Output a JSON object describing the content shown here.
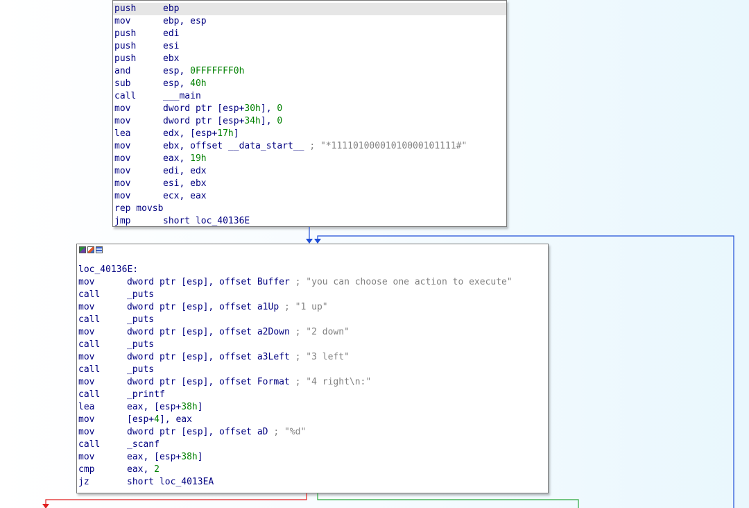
{
  "block1": {
    "lines": [
      {
        "mn": "push",
        "ops": [
          {
            "t": "ebp"
          }
        ]
      },
      {
        "mn": "mov",
        "ops": [
          {
            "t": "ebp, esp"
          }
        ]
      },
      {
        "mn": "push",
        "ops": [
          {
            "t": "edi"
          }
        ]
      },
      {
        "mn": "push",
        "ops": [
          {
            "t": "esi"
          }
        ]
      },
      {
        "mn": "push",
        "ops": [
          {
            "t": "ebx"
          }
        ]
      },
      {
        "mn": "and",
        "ops": [
          {
            "t": "esp, "
          },
          {
            "t": "0FFFFFFF0h",
            "c": "num"
          }
        ]
      },
      {
        "mn": "sub",
        "ops": [
          {
            "t": "esp, "
          },
          {
            "t": "40h",
            "c": "num"
          }
        ]
      },
      {
        "mn": "call",
        "ops": [
          {
            "t": "___main"
          }
        ]
      },
      {
        "mn": "mov",
        "ops": [
          {
            "t": "dword ptr [esp+"
          },
          {
            "t": "30h",
            "c": "num"
          },
          {
            "t": "], "
          },
          {
            "t": "0",
            "c": "num"
          }
        ]
      },
      {
        "mn": "mov",
        "ops": [
          {
            "t": "dword ptr [esp+"
          },
          {
            "t": "34h",
            "c": "num"
          },
          {
            "t": "], "
          },
          {
            "t": "0",
            "c": "num"
          }
        ]
      },
      {
        "mn": "lea",
        "ops": [
          {
            "t": "edx, [esp+"
          },
          {
            "t": "17h",
            "c": "num"
          },
          {
            "t": "]"
          }
        ]
      },
      {
        "mn": "mov",
        "ops": [
          {
            "t": "ebx, offset __data_start__ "
          },
          {
            "t": "; \"*11110100001010000101111#\"",
            "c": "cmt"
          }
        ]
      },
      {
        "mn": "mov",
        "ops": [
          {
            "t": "eax, "
          },
          {
            "t": "19h",
            "c": "num"
          }
        ]
      },
      {
        "mn": "mov",
        "ops": [
          {
            "t": "edi, edx"
          }
        ]
      },
      {
        "mn": "mov",
        "ops": [
          {
            "t": "esi, ebx"
          }
        ]
      },
      {
        "mn": "mov",
        "ops": [
          {
            "t": "ecx, eax"
          }
        ]
      },
      {
        "mn": "rep movsb",
        "ops": []
      },
      {
        "mn": "jmp",
        "ops": [
          {
            "t": "short loc_40136E"
          }
        ]
      }
    ]
  },
  "block2": {
    "label": "loc_40136E:",
    "lines": [
      {
        "mn": "mov",
        "ops": [
          {
            "t": "dword ptr [esp], offset Buffer "
          },
          {
            "t": "; \"you can choose one action to execute\"",
            "c": "cmt"
          }
        ]
      },
      {
        "mn": "call",
        "ops": [
          {
            "t": "_puts"
          }
        ]
      },
      {
        "mn": "mov",
        "ops": [
          {
            "t": "dword ptr [esp], offset a1Up "
          },
          {
            "t": "; \"1 up\"",
            "c": "cmt"
          }
        ]
      },
      {
        "mn": "call",
        "ops": [
          {
            "t": "_puts"
          }
        ]
      },
      {
        "mn": "mov",
        "ops": [
          {
            "t": "dword ptr [esp], offset a2Down "
          },
          {
            "t": "; \"2 down\"",
            "c": "cmt"
          }
        ]
      },
      {
        "mn": "call",
        "ops": [
          {
            "t": "_puts"
          }
        ]
      },
      {
        "mn": "mov",
        "ops": [
          {
            "t": "dword ptr [esp], offset a3Left "
          },
          {
            "t": "; \"3 left\"",
            "c": "cmt"
          }
        ]
      },
      {
        "mn": "call",
        "ops": [
          {
            "t": "_puts"
          }
        ]
      },
      {
        "mn": "mov",
        "ops": [
          {
            "t": "dword ptr [esp], offset Format "
          },
          {
            "t": "; \"4 right\\n:\"",
            "c": "cmt"
          }
        ]
      },
      {
        "mn": "call",
        "ops": [
          {
            "t": "_printf"
          }
        ]
      },
      {
        "mn": "lea",
        "ops": [
          {
            "t": "eax, [esp+"
          },
          {
            "t": "38h",
            "c": "num"
          },
          {
            "t": "]"
          }
        ]
      },
      {
        "mn": "mov",
        "ops": [
          {
            "t": "[esp+"
          },
          {
            "t": "4",
            "c": "num"
          },
          {
            "t": "], eax"
          }
        ]
      },
      {
        "mn": "mov",
        "ops": [
          {
            "t": "dword ptr [esp], offset aD "
          },
          {
            "t": "; \"%d\"",
            "c": "cmt"
          }
        ]
      },
      {
        "mn": "call",
        "ops": [
          {
            "t": "_scanf"
          }
        ]
      },
      {
        "mn": "mov",
        "ops": [
          {
            "t": "eax, [esp+"
          },
          {
            "t": "38h",
            "c": "num"
          },
          {
            "t": "]"
          }
        ]
      },
      {
        "mn": "cmp",
        "ops": [
          {
            "t": "eax, "
          },
          {
            "t": "2",
            "c": "num"
          }
        ]
      },
      {
        "mn": "jz",
        "ops": [
          {
            "t": "short loc_4013EA"
          }
        ]
      }
    ]
  },
  "titlebar_icons": [
    "graph-icon",
    "edit-icon",
    "listing-icon"
  ],
  "colors": {
    "text": "#000080",
    "number": "#008000",
    "comment": "#808080",
    "edge_normal": "#1f4ed8",
    "edge_true": "#2aa83c",
    "edge_false": "#e02020"
  }
}
